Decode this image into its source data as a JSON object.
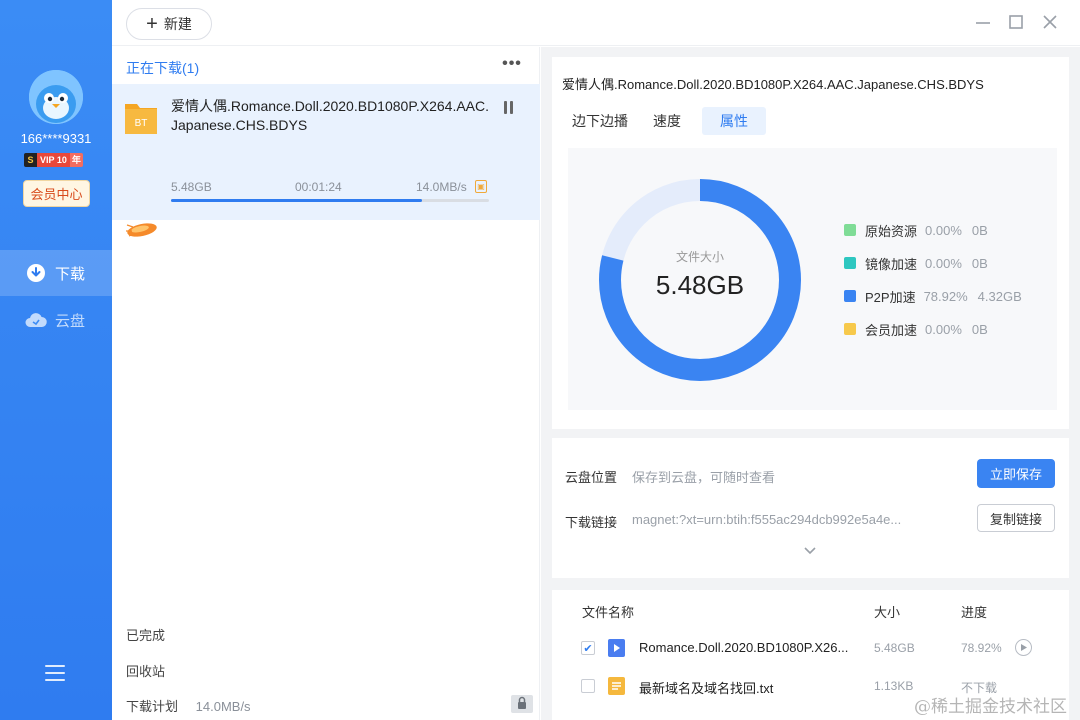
{
  "sidebar": {
    "username": "166****9331",
    "vip": {
      "s": "S",
      "label": "VIP 10",
      "years": "年"
    },
    "member_center": "会员中心",
    "nav": [
      {
        "label": "下载",
        "icon": "download-icon",
        "active": true
      },
      {
        "label": "云盘",
        "icon": "cloud-icon",
        "active": false
      }
    ]
  },
  "topbar": {
    "new_label": "新建"
  },
  "list": {
    "section_title": "正在下载(1)",
    "task": {
      "badge": "BT",
      "name": "爱情人偶.Romance.Doll.2020.BD1080P.X264.AAC.Japanese.CHS.BDYS",
      "size": "5.48GB",
      "time": "00:01:24",
      "speed": "14.0MB/s",
      "progress": 0.79
    },
    "completed": "已完成",
    "recycle": "回收站",
    "plan_label": "下载计划",
    "plan_speed": "14.0MB/s"
  },
  "detail": {
    "title": "爱情人偶.Romance.Doll.2020.BD1080P.X264.AAC.Japanese.CHS.BDYS",
    "tabs": [
      "边下边播",
      "速度",
      "属性"
    ],
    "active_tab": 2,
    "chart_data": {
      "type": "pie",
      "center_label": "文件大小",
      "center_value": "5.48GB",
      "slices": [
        {
          "name": "原始资源",
          "percent": 0.0,
          "percent_text": "0.00%",
          "size": "0B",
          "color": "#7fdc96"
        },
        {
          "name": "镜像加速",
          "percent": 0.0,
          "percent_text": "0.00%",
          "size": "0B",
          "color": "#2ec7c0"
        },
        {
          "name": "P2P加速",
          "percent": 78.92,
          "percent_text": "78.92%",
          "size": "4.32GB",
          "color": "#3a84f2"
        },
        {
          "name": "会员加速",
          "percent": 0.0,
          "percent_text": "0.00%",
          "size": "0B",
          "color": "#f7c94b"
        }
      ],
      "remainder_color": "#e4ecfb"
    },
    "cloud_label": "云盘位置",
    "cloud_value": "保存到云盘，可随时查看",
    "save_button": "立即保存",
    "link_label": "下载链接",
    "link_value": "magnet:?xt=urn:btih:f555ac294dcb992e5a4e...",
    "copy_button": "复制链接",
    "files": {
      "headers": {
        "name": "文件名称",
        "size": "大小",
        "progress": "进度"
      },
      "rows": [
        {
          "checked": true,
          "type": "video",
          "name": "Romance.Doll.2020.BD1080P.X26...",
          "size": "5.48GB",
          "progress": "78.92%",
          "type_color": "#4a7df0"
        },
        {
          "checked": false,
          "type": "text",
          "name": "最新域名及域名找回.txt",
          "size": "1.13KB",
          "progress": "不下载",
          "type_color": "#f5b83d"
        }
      ]
    }
  },
  "watermark": "@稀土掘金技术社区",
  "colors": {
    "accent": "#2f7cf0",
    "sidebar": "#3b8cf5"
  }
}
